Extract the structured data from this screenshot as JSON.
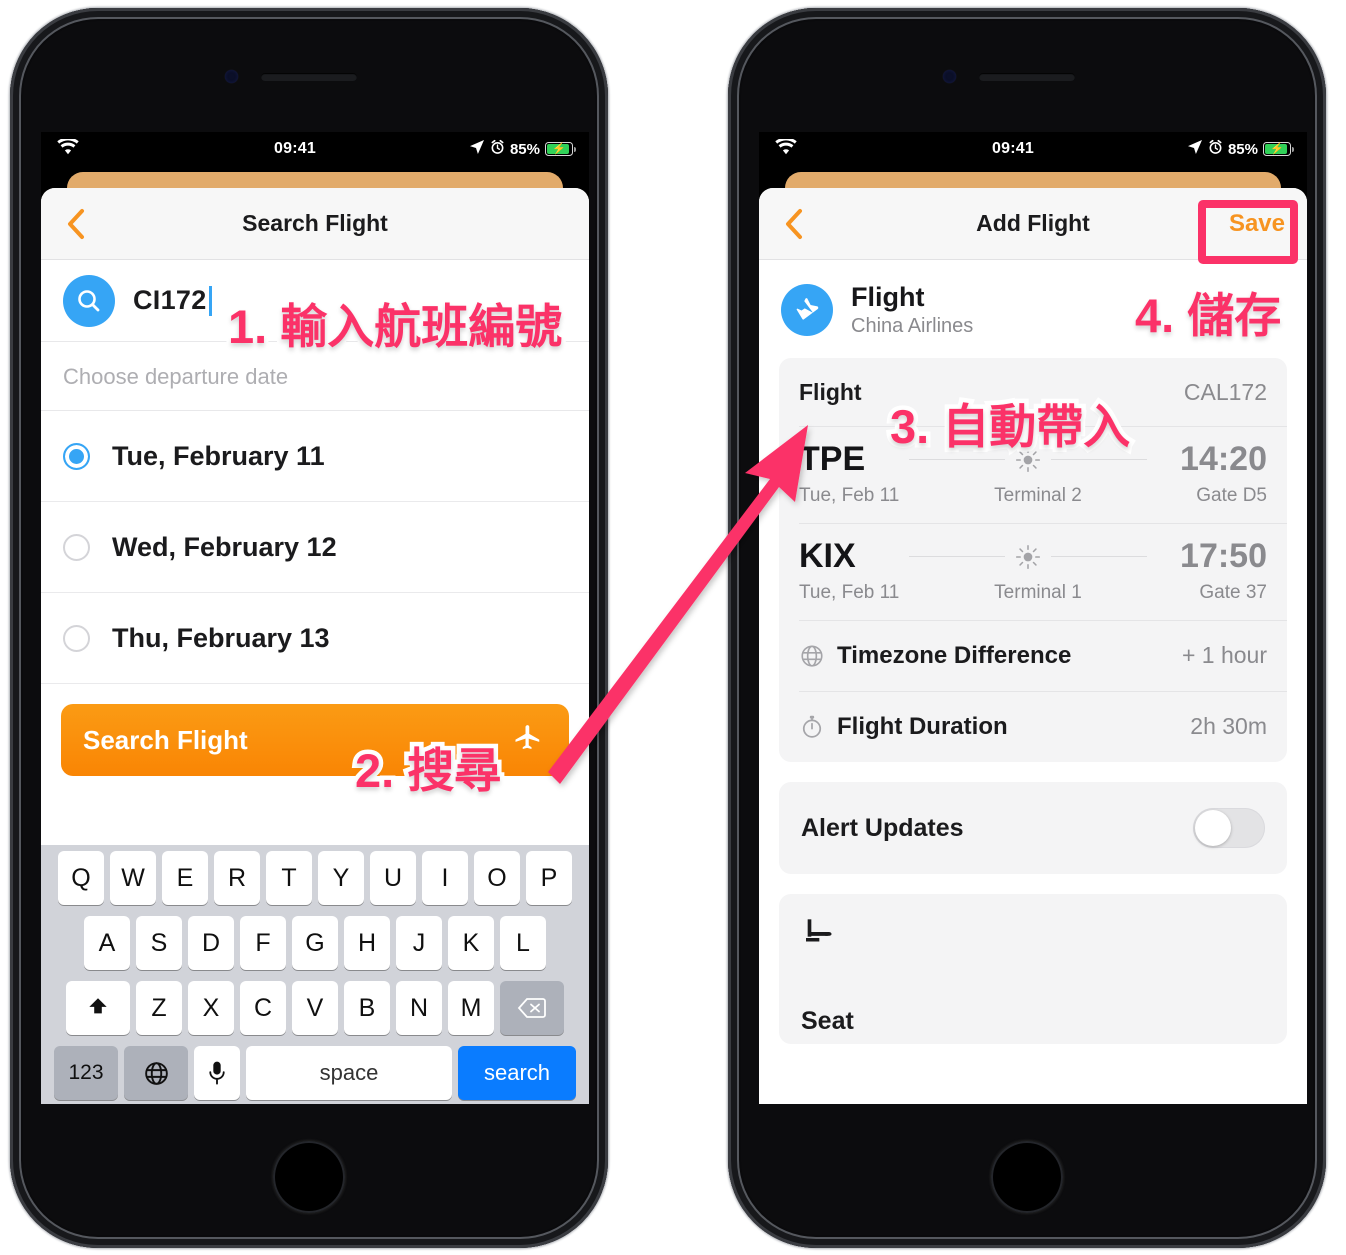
{
  "status_bar": {
    "time": "09:41",
    "battery_percent": "85%",
    "wifi_icon": "wifi-icon",
    "location_icon": "location-arrow-icon",
    "alarm_icon": "alarm-clock-icon",
    "battery_icon": "battery-charging-icon"
  },
  "left_phone": {
    "nav": {
      "back_icon": "chevron-left-icon",
      "title": "Search Flight"
    },
    "search": {
      "icon": "search-icon",
      "value": "CI172"
    },
    "section_label": "Choose departure date",
    "dates": [
      {
        "label": "Tue, February 11",
        "selected": true
      },
      {
        "label": "Wed, February 12",
        "selected": false
      },
      {
        "label": "Thu, February 13",
        "selected": false
      }
    ],
    "search_button": {
      "label": "Search Flight",
      "icon": "airplane-icon"
    },
    "keyboard": {
      "row1": [
        "Q",
        "W",
        "E",
        "R",
        "T",
        "Y",
        "U",
        "I",
        "O",
        "P"
      ],
      "row2": [
        "A",
        "S",
        "D",
        "F",
        "G",
        "H",
        "J",
        "K",
        "L"
      ],
      "row3": [
        "Z",
        "X",
        "C",
        "V",
        "B",
        "N",
        "M"
      ],
      "shift_icon": "shift-arrow-icon",
      "backspace_icon": "backspace-icon",
      "numbers_key": "123",
      "globe_icon": "globe-icon",
      "mic_icon": "microphone-icon",
      "space_key": "space",
      "search_key": "search"
    }
  },
  "right_phone": {
    "nav": {
      "back_icon": "chevron-left-icon",
      "title": "Add Flight",
      "save_label": "Save"
    },
    "header": {
      "icon": "airplane-circle-icon",
      "title": "Flight",
      "subtitle": "China Airlines"
    },
    "flight_number": {
      "label": "Flight",
      "value": "CAL172"
    },
    "legs": [
      {
        "code": "TPE",
        "time": "14:20",
        "date": "Tue, Feb 11",
        "terminal": "Terminal 2",
        "gate": "Gate D5",
        "weather_icon": "sun-icon"
      },
      {
        "code": "KIX",
        "time": "17:50",
        "date": "Tue, Feb 11",
        "terminal": "Terminal 1",
        "gate": "Gate 37",
        "weather_icon": "sun-icon"
      }
    ],
    "info_rows": [
      {
        "icon": "globe-icon",
        "label": "Timezone Difference",
        "value": "+ 1 hour"
      },
      {
        "icon": "stopwatch-icon",
        "label": "Flight Duration",
        "value": "2h 30m"
      }
    ],
    "alert": {
      "label": "Alert Updates",
      "enabled": false
    },
    "seat": {
      "icon": "airline-seat-icon",
      "label": "Seat"
    }
  },
  "annotations": [
    {
      "id": "step-1",
      "text": "1. 輸入航班編號"
    },
    {
      "id": "step-2",
      "text": "2. 搜尋"
    },
    {
      "id": "step-3",
      "text": "3. 自動帶入"
    },
    {
      "id": "step-4",
      "text": "4. 儲存"
    }
  ],
  "colors": {
    "annotation_pink": "#fb3268",
    "accent_orange": "#f79421",
    "accent_blue": "#36a5f5",
    "keyboard_return_blue": "#0a7cff",
    "battery_green": "#31d158"
  }
}
